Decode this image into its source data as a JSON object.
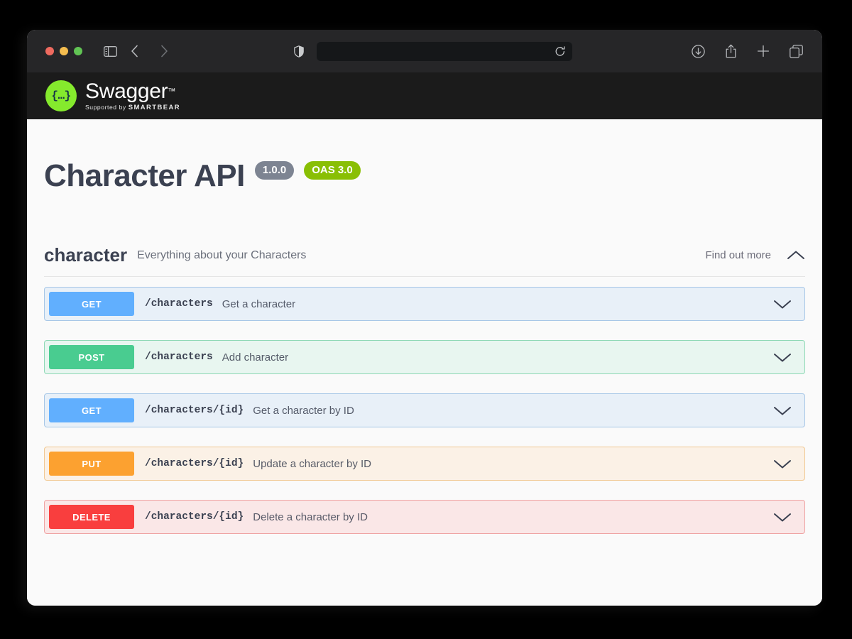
{
  "browser": {
    "traffic_lights": [
      "close",
      "minimize",
      "maximize"
    ],
    "sidebar_toggle": "sidebar-toggle-icon",
    "back": "back-chevron-icon",
    "forward": "forward-chevron-icon",
    "shield": "privacy-shield-icon",
    "url_value": "",
    "url_placeholder": "",
    "reload": "reload-icon",
    "downloads": "downloads-icon",
    "share": "share-icon",
    "new_tab": "plus-icon",
    "tab_overview": "tab-overview-icon"
  },
  "header": {
    "logo_braces": "{…}",
    "title": "Swagger",
    "trademark": "™",
    "supported_by": "Supported by",
    "brand": "SMARTBEAR"
  },
  "info": {
    "title": "Character API",
    "version": "1.0.0",
    "spec": "OAS 3.0"
  },
  "tag": {
    "name": "character",
    "description": "Everything about your Characters",
    "find_out_more": "Find out more",
    "collapse_icon": "chevron-up-icon"
  },
  "operations": [
    {
      "method": "GET",
      "path": "/characters",
      "summary": "Get a character",
      "expand_icon": "chevron-down-icon",
      "color": "#61affe"
    },
    {
      "method": "POST",
      "path": "/characters",
      "summary": "Add character",
      "expand_icon": "chevron-down-icon",
      "color": "#49cc90"
    },
    {
      "method": "GET",
      "path": "/characters/{id}",
      "summary": "Get a character by ID",
      "expand_icon": "chevron-down-icon",
      "color": "#61affe"
    },
    {
      "method": "PUT",
      "path": "/characters/{id}",
      "summary": "Update a character by ID",
      "expand_icon": "chevron-down-icon",
      "color": "#fca130"
    },
    {
      "method": "DELETE",
      "path": "/characters/{id}",
      "summary": "Delete a character by ID",
      "expand_icon": "chevron-down-icon",
      "color": "#f93e3e"
    }
  ],
  "colors": {
    "swagger_green": "#85ea2d",
    "oas_green": "#89bf04",
    "version_gray": "#7d8492",
    "text": "#3b4151",
    "page_bg": "#fafafa",
    "header_bg": "#1b1b1b",
    "toolbar_bg": "#262628"
  }
}
